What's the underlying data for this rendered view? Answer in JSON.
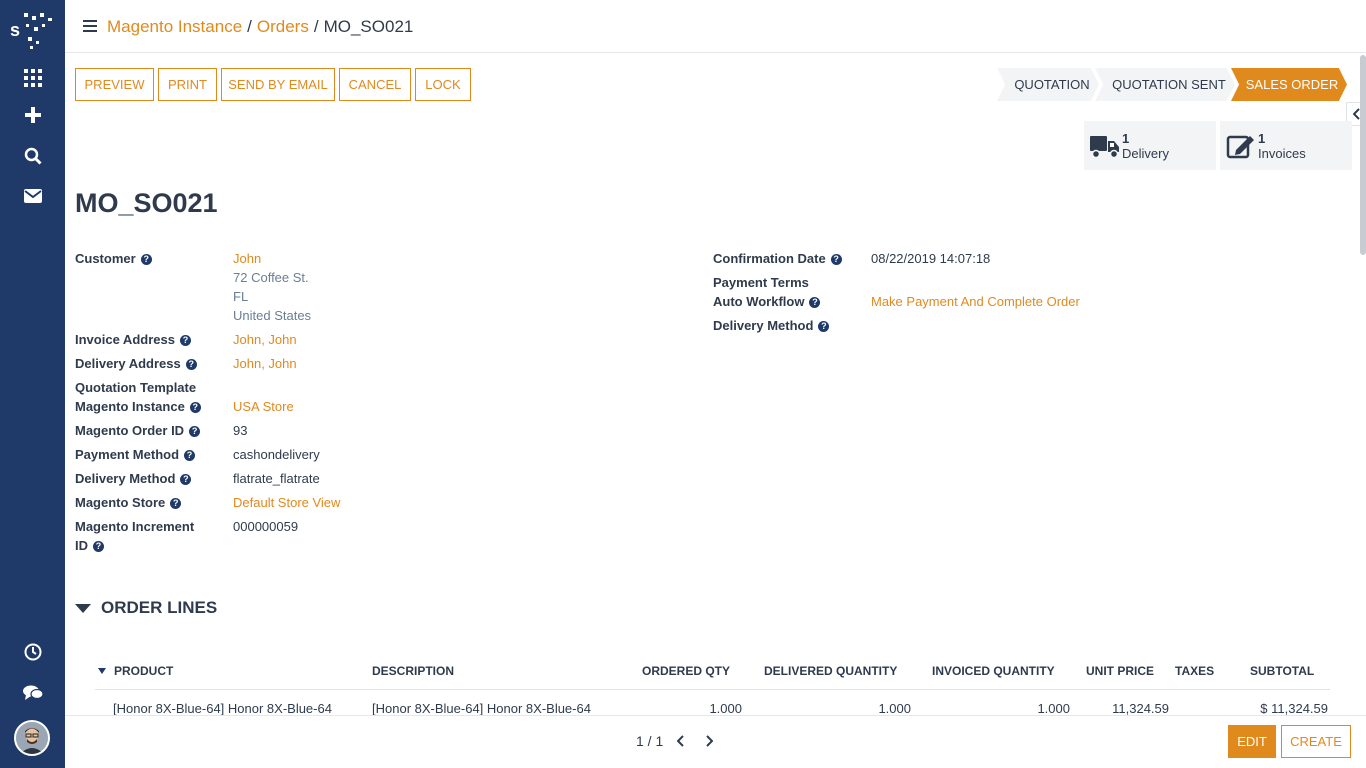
{
  "breadcrumb": {
    "instance": "Magento Instance",
    "orders": "Orders",
    "current": "MO_SO021"
  },
  "actions": {
    "preview": "PREVIEW",
    "print": "PRINT",
    "send_email": "SEND BY EMAIL",
    "cancel": "CANCEL",
    "lock": "LOCK"
  },
  "stages": {
    "quotation": "QUOTATION",
    "quotation_sent": "QUOTATION SENT",
    "sales_order": "SALES ORDER",
    "active": "SALES ORDER"
  },
  "smart_buttons": {
    "delivery": {
      "count": "1",
      "label": "Delivery"
    },
    "invoices": {
      "count": "1",
      "label": "Invoices"
    }
  },
  "record": {
    "title": "MO_SO021"
  },
  "left_fields": {
    "customer_label": "Customer",
    "customer_name": "John",
    "address_line1": "72 Coffee St.",
    "address_line2": "FL",
    "address_line3": "United States",
    "invoice_address_label": "Invoice Address",
    "invoice_address": "John, John",
    "delivery_address_label": "Delivery Address",
    "delivery_address": "John, John",
    "quotation_template_label": "Quotation Template",
    "magento_instance_label": "Magento Instance",
    "magento_instance": "USA Store",
    "magento_order_id_label": "Magento Order ID",
    "magento_order_id": "93",
    "payment_method_label": "Payment Method",
    "payment_method": "cashondelivery",
    "delivery_method_label": "Delivery Method",
    "delivery_method": "flatrate_flatrate",
    "magento_store_label": "Magento Store",
    "magento_store": "Default Store View",
    "increment_label_1": "Magento Increment",
    "increment_label_2": "ID",
    "increment_id": "000000059"
  },
  "right_fields": {
    "confirmation_date_label": "Confirmation Date",
    "confirmation_date": "08/22/2019 14:07:18",
    "payment_terms_label": "Payment Terms",
    "auto_workflow_label": "Auto Workflow",
    "auto_workflow": "Make Payment And Complete Order",
    "delivery_method_label": "Delivery Method"
  },
  "help_glyph": "?",
  "order_lines": {
    "heading": "ORDER LINES",
    "columns": {
      "product": "PRODUCT",
      "description": "DESCRIPTION",
      "ordered_qty": "ORDERED QTY",
      "delivered_qty": "DELIVERED QUANTITY",
      "invoiced_qty": "INVOICED QUANTITY",
      "unit_price": "UNIT PRICE",
      "taxes": "TAXES",
      "subtotal": "SUBTOTAL"
    },
    "rows": [
      {
        "product": "[Honor 8X-Blue-64] Honor 8X-Blue-64",
        "description": "[Honor  8X-Blue-64] Honor  8X-Blue-64",
        "ordered_qty": "1.000",
        "delivered_qty": "1.000",
        "invoiced_qty": "1.000",
        "unit_price": "11,324.59",
        "taxes": "",
        "subtotal": "$ 11,324.59"
      }
    ]
  },
  "footer": {
    "pager": "1 / 1",
    "edit": "EDIT",
    "create": "CREATE"
  },
  "colors": {
    "accent": "#e08a1e",
    "sidebar": "#1f3a68",
    "text": "#2f3b4c",
    "stage_bg": "#f3f4f6"
  }
}
